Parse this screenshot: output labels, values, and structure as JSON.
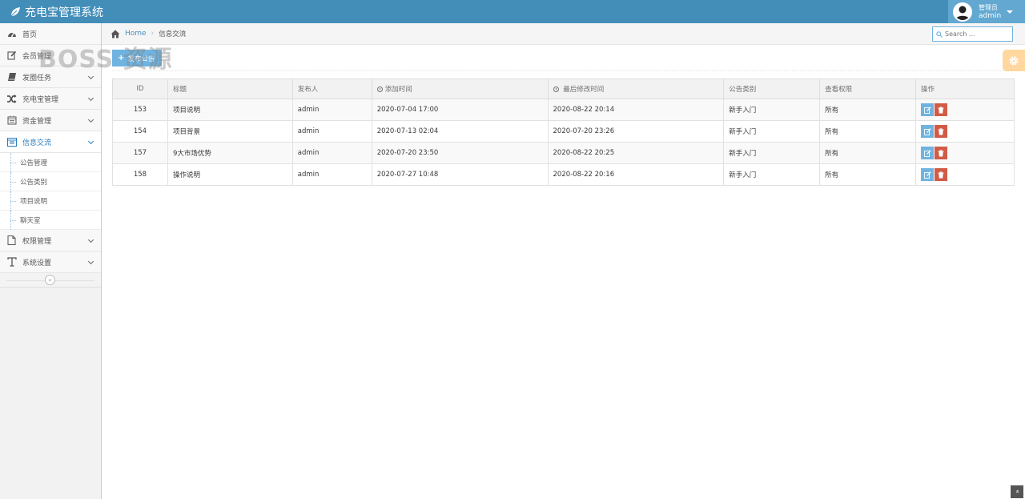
{
  "app": {
    "title": "充电宝管理系统"
  },
  "user": {
    "role": "管理员",
    "name": "admin"
  },
  "sidebar": {
    "items": [
      {
        "label": "首页",
        "icon": "dashboard-icon"
      },
      {
        "label": "会员管理",
        "icon": "edit-icon"
      },
      {
        "label": "发圈任务",
        "icon": "book-icon"
      },
      {
        "label": "充电宝管理",
        "icon": "shuffle-icon"
      },
      {
        "label": "资金管理",
        "icon": "calendar-icon"
      },
      {
        "label": "信息交流",
        "icon": "list-alt-icon"
      },
      {
        "label": "权限管理",
        "icon": "file-icon"
      },
      {
        "label": "系统设置",
        "icon": "text-icon"
      }
    ],
    "sub_items": [
      "公告管理",
      "公告类别",
      "项目说明",
      "聊天室"
    ],
    "collapse_glyph": "«"
  },
  "breadcrumb": {
    "home": "Home",
    "current": "信息交流"
  },
  "search": {
    "placeholder": "Search ..."
  },
  "watermark": "BOSS 资源",
  "toolbar": {
    "plus": "+",
    "publish_label": "发布公告"
  },
  "table": {
    "headers": [
      "ID",
      "标题",
      "发布人",
      "添加时间",
      "最后修改时间",
      "公告类别",
      "查看权限",
      "操作"
    ],
    "rows": [
      {
        "id": "153",
        "title": "项目说明",
        "author": "admin",
        "added": "2020-07-04 17:00",
        "modified": "2020-08-22 20:14",
        "category": "新手入门",
        "permission": "所有"
      },
      {
        "id": "154",
        "title": "项目背景",
        "author": "admin",
        "added": "2020-07-13 02:04",
        "modified": "2020-07-20 23:26",
        "category": "新手入门",
        "permission": "所有"
      },
      {
        "id": "157",
        "title": "9大市场优势",
        "author": "admin",
        "added": "2020-07-20 23:50",
        "modified": "2020-08-22 20:25",
        "category": "新手入门",
        "permission": "所有"
      },
      {
        "id": "158",
        "title": "操作说明",
        "author": "admin",
        "added": "2020-07-27 10:48",
        "modified": "2020-08-22 20:16",
        "category": "新手入门",
        "permission": "所有"
      }
    ]
  },
  "scroll_top_glyph": "»",
  "colors": {
    "navbar": "#438eb9",
    "user_box": "#62a8d1",
    "edit_button": "#6fb3e0",
    "delete_button": "#d15b47",
    "active_nav": "#2b7dbc",
    "settings_tab": "#ffb752"
  }
}
